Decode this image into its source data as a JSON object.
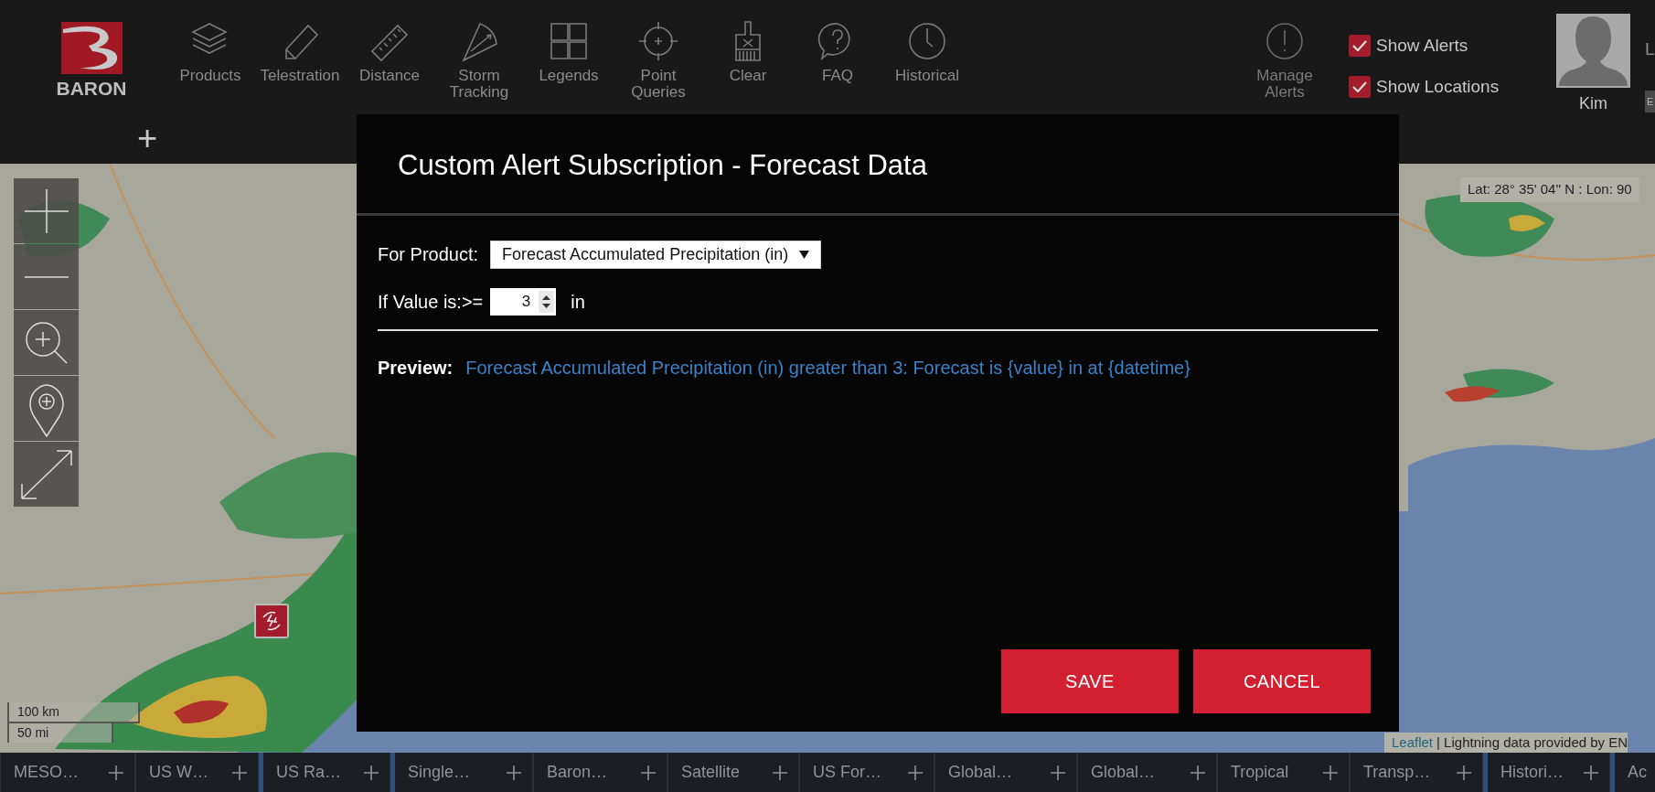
{
  "header": {
    "logo_text": "BARON",
    "tools": [
      {
        "label": "Products"
      },
      {
        "label": "Telestration"
      },
      {
        "label": "Distance"
      },
      {
        "label": "Storm Tracking"
      },
      {
        "label": "Legends"
      },
      {
        "label": "Point Queries"
      },
      {
        "label": "Clear"
      },
      {
        "label": "FAQ"
      },
      {
        "label": "Historical"
      }
    ],
    "add_button": "+",
    "manage_alerts": "Manage Alerts",
    "toggles": [
      {
        "label": "Show Alerts",
        "checked": true
      },
      {
        "label": "Show Locations",
        "checked": true
      }
    ],
    "user": {
      "name": "Kim",
      "cut_link": "L",
      "cut_button": "E"
    }
  },
  "map": {
    "coordinates": "Lat: 28° 35' 04'' N : Lon: 90",
    "scale": [
      "100 km",
      "50 mi"
    ],
    "attribution_link": "Leaflet",
    "attribution_text": "| Lightning data provided by EN"
  },
  "modal": {
    "title": "Custom Alert Subscription - Forecast Data",
    "product_label": "For Product:",
    "product_value": "Forecast Accumulated Precipitation (in)",
    "value_label": "If Value is:>=",
    "value": "3",
    "unit": "in",
    "preview_label": "Preview:",
    "preview_text": "Forecast Accumulated Precipitation (in) greater than 3: Forecast is {value} in at {datetime}",
    "buttons": [
      "SAVE",
      "CANCEL"
    ]
  },
  "tabs": [
    {
      "label": "MESO…",
      "group_start": false
    },
    {
      "label": "US W…",
      "group_start": false
    },
    {
      "label": "US Ra…",
      "group_start": true
    },
    {
      "label": "Single…",
      "group_start": true
    },
    {
      "label": "Baron…",
      "group_start": false
    },
    {
      "label": "Satellite",
      "group_start": false
    },
    {
      "label": "US For…",
      "group_start": false
    },
    {
      "label": "Global…",
      "group_start": false
    },
    {
      "label": "Global…",
      "group_start": false
    },
    {
      "label": "Tropical",
      "group_start": false
    },
    {
      "label": "Transp…",
      "group_start": false
    },
    {
      "label": "Histori…",
      "group_start": true
    },
    {
      "label": "Ac",
      "group_start": true
    }
  ]
}
